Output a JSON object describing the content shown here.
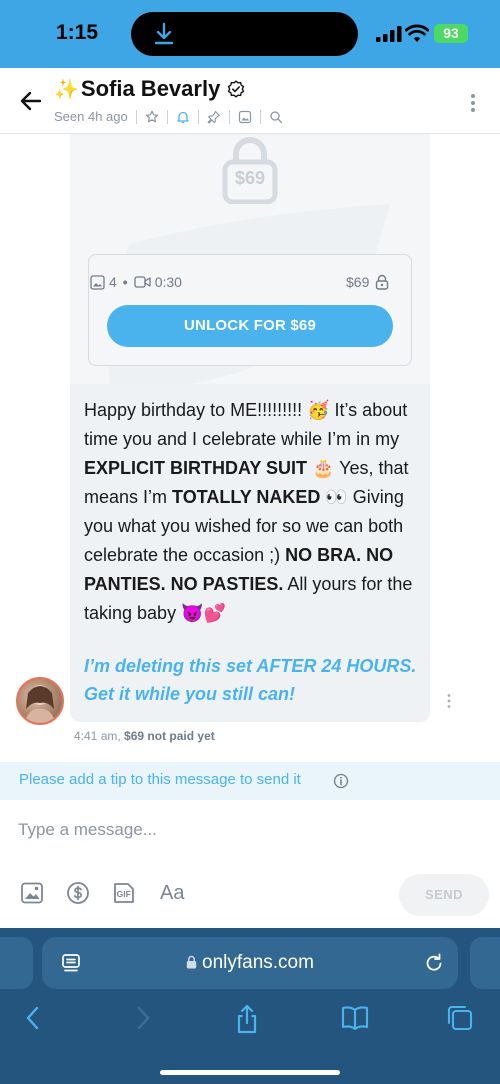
{
  "status_bar": {
    "time": "1:15",
    "battery": "93"
  },
  "header": {
    "name": "Sofia Bevarly",
    "sparkle": "✨",
    "last_seen": "Seen 4h ago",
    "icons": [
      "star-icon",
      "bell-icon",
      "pin-icon",
      "gallery-icon",
      "search-icon"
    ]
  },
  "message": {
    "locked_price": "$69",
    "media_stats": {
      "photos": "4",
      "video_duration": "0:30"
    },
    "card_price": "$69",
    "unlock_label": "UNLOCK FOR $69",
    "text": {
      "l1": "Happy birthday to ME!!!!!!!!! 🥳 It’s about",
      "l2": "time you and I celebrate while I’m in my",
      "l3a": "EXPLICIT BIRTHDAY SUIT",
      "l3b": " 🎂 Yes, that",
      "l4a": "means I’m ",
      "l4b": "TOTALLY NAKED",
      "l4c": " 👀 Giving",
      "l5": "you what you wished for so we can both",
      "l6a": "celebrate the occasion ;) ",
      "l6b": "NO BRA. NO",
      "l7a": "PANTIES. NO PASTIES.",
      "l7b": " All yours for the",
      "l8": "taking baby 😈💕"
    },
    "warning_l1": "I’m deleting this set AFTER 24 HOURS.",
    "warning_l2": "Get it while you still can!",
    "time": "4:41 am,",
    "payment_status": "$69 not paid yet"
  },
  "tip_bar": {
    "text": "Please add a tip to this message to send it"
  },
  "composer": {
    "placeholder": "Type a message...",
    "font_label": "Aa",
    "gif_label": "GIF",
    "send_label": "SEND"
  },
  "browser": {
    "url": "onlyfans.com"
  },
  "colors": {
    "accent": "#4ab3ee",
    "status_bar": "#3fa6e6",
    "browser_bar": "#24557e"
  }
}
